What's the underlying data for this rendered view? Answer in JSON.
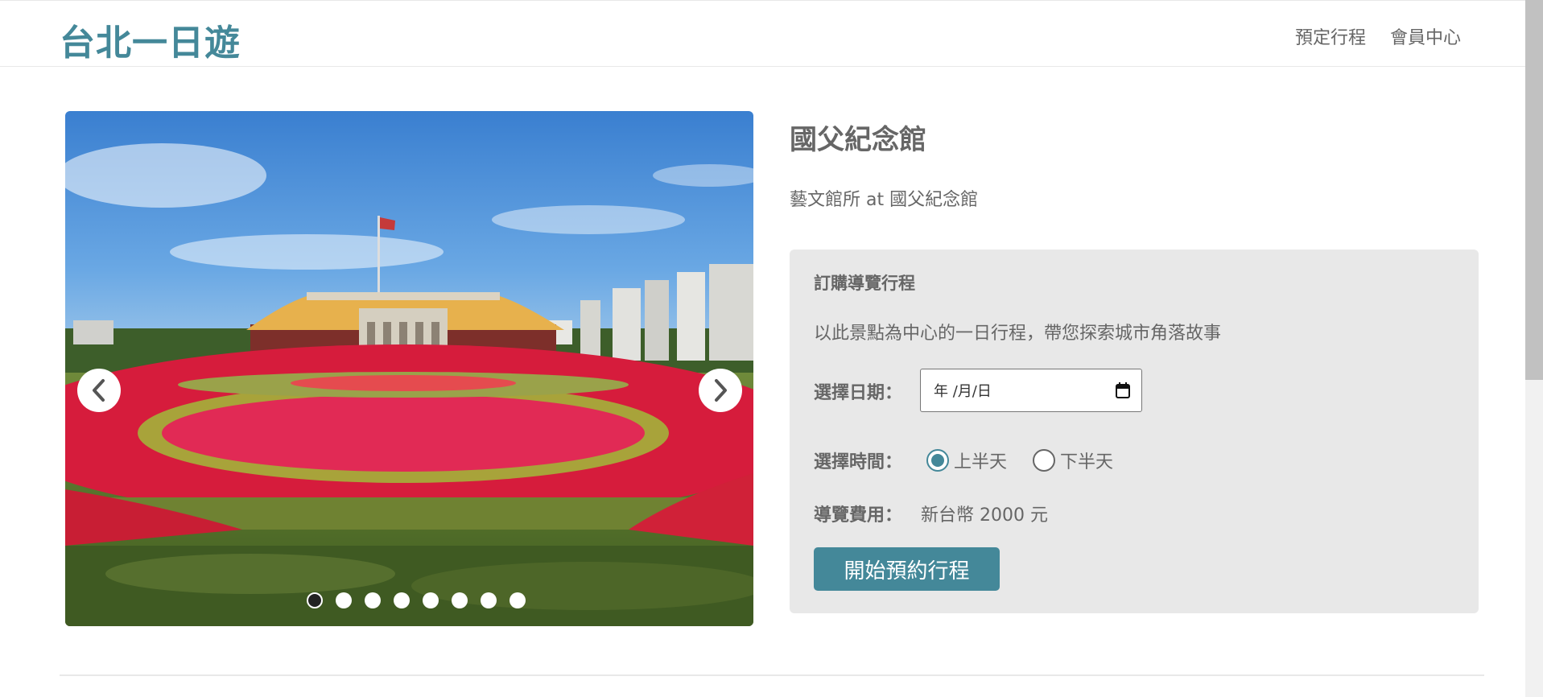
{
  "header": {
    "brand": "台北一日遊",
    "nav": [
      "預定行程",
      "會員中心"
    ]
  },
  "attraction": {
    "name": "國父紀念館",
    "subtitle": "藝文館所 at 國父紀念館"
  },
  "carousel": {
    "image_count": 8,
    "active_index": 0
  },
  "booking": {
    "heading": "訂購導覽行程",
    "description": "以此景點為中心的一日行程，帶您探索城市角落故事",
    "date_label": "選擇日期：",
    "date_placeholder": "年 /月/日",
    "time_label": "選擇時間：",
    "time_options": [
      "上半天",
      "下半天"
    ],
    "time_selected": "上半天",
    "fee_label": "導覽費用：",
    "fee_value": "新台幣 2000 元",
    "submit_label": "開始預約行程"
  },
  "colors": {
    "accent": "#448899",
    "panel_bg": "#e8e8e8",
    "text": "#666666"
  },
  "icons": [
    "chevron-left-icon",
    "chevron-right-icon",
    "calendar-icon"
  ]
}
